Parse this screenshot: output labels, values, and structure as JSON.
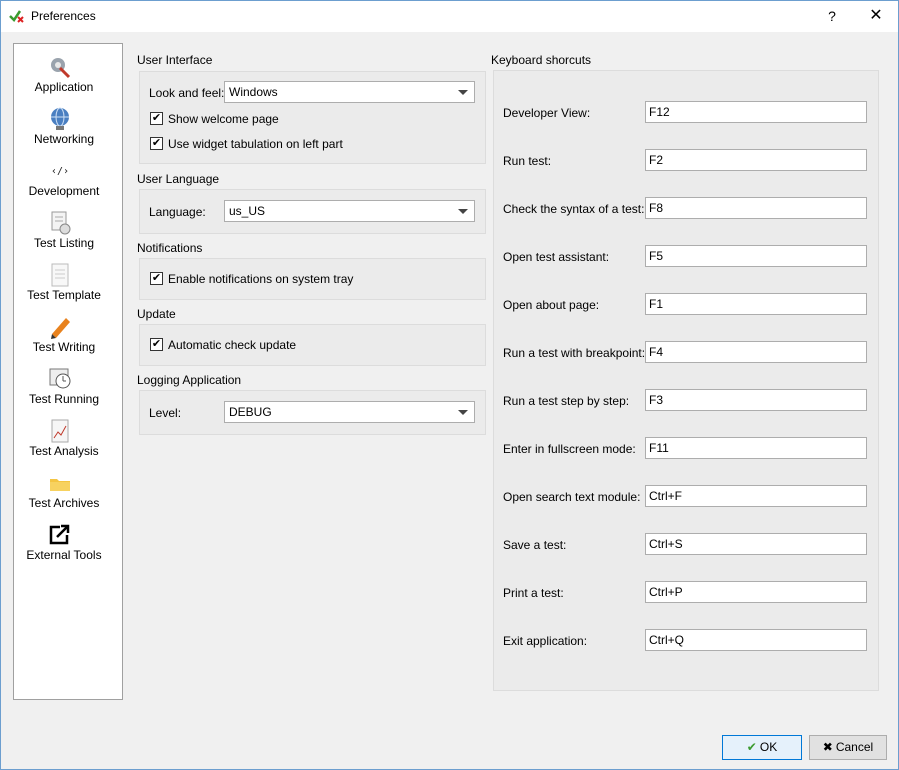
{
  "window": {
    "title": "Preferences",
    "help_label": "?",
    "close_label": "✕"
  },
  "sidebar": {
    "items": [
      {
        "label": "Application",
        "icon": "application-icon"
      },
      {
        "label": "Networking",
        "icon": "network-globe-icon"
      },
      {
        "label": "Development",
        "icon": "code-icon"
      },
      {
        "label": "Test Listing",
        "icon": "test-listing-icon"
      },
      {
        "label": "Test Template",
        "icon": "document-template-icon"
      },
      {
        "label": "Test Writing",
        "icon": "pencil-icon"
      },
      {
        "label": "Test Running",
        "icon": "clock-running-icon"
      },
      {
        "label": "Test Analysis",
        "icon": "chart-analysis-icon"
      },
      {
        "label": "Test Archives",
        "icon": "folder-icon"
      },
      {
        "label": "External Tools",
        "icon": "external-link-icon"
      }
    ]
  },
  "user_interface": {
    "title": "User Interface",
    "look_feel_label": "Look and feel:",
    "look_feel_value": "Windows",
    "show_welcome_label": "Show welcome page",
    "show_welcome_checked": true,
    "widget_tab_label": "Use widget tabulation on left part",
    "widget_tab_checked": true
  },
  "user_language": {
    "title": "User Language",
    "language_label": "Language:",
    "language_value": "us_US"
  },
  "notifications": {
    "title": "Notifications",
    "enable_label": "Enable notifications on system tray",
    "enable_checked": true
  },
  "update": {
    "title": "Update",
    "auto_label": "Automatic check update",
    "auto_checked": true
  },
  "logging": {
    "title": "Logging Application",
    "level_label": "Level:",
    "level_value": "DEBUG"
  },
  "shortcuts": {
    "title": "Keyboard shorcuts",
    "items": [
      {
        "label": "Developer View:",
        "value": "F12"
      },
      {
        "label": "Run test:",
        "value": "F2"
      },
      {
        "label": "Check the syntax of a test:",
        "value": "F8"
      },
      {
        "label": "Open test assistant:",
        "value": "F5"
      },
      {
        "label": "Open about page:",
        "value": "F1"
      },
      {
        "label": "Run a test with breakpoint:",
        "value": "F4"
      },
      {
        "label": "Run a test step by step:",
        "value": "F3"
      },
      {
        "label": "Enter in fullscreen mode:",
        "value": "F11"
      },
      {
        "label": "Open search text module:",
        "value": "Ctrl+F"
      },
      {
        "label": "Save a test:",
        "value": "Ctrl+S"
      },
      {
        "label": "Print a test:",
        "value": "Ctrl+P"
      },
      {
        "label": "Exit application:",
        "value": "Ctrl+Q"
      }
    ]
  },
  "buttons": {
    "ok_label": "OK",
    "cancel_label": "Cancel"
  },
  "colors": {
    "accent": "#0078d7",
    "ok_icon": "#3a9b2f",
    "cancel_icon": "#000000"
  }
}
